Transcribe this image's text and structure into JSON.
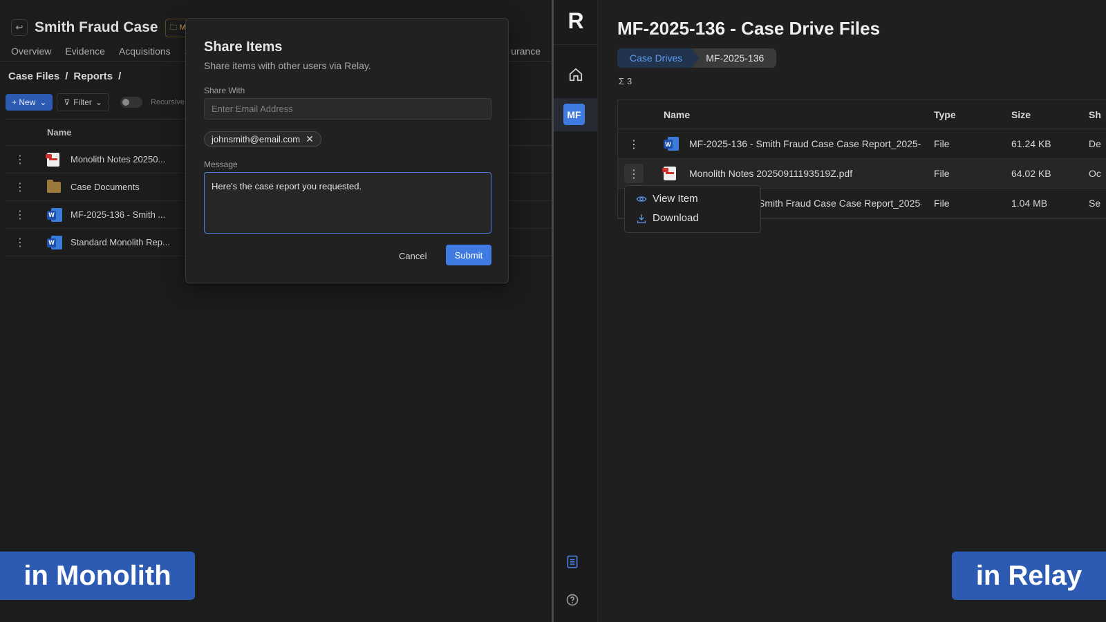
{
  "monolith": {
    "case_title": "Smith Fraud Case",
    "case_chip": "MF",
    "tabs": [
      "Overview",
      "Evidence",
      "Acquisitions",
      "S"
    ],
    "tab_tail": "urance",
    "breadcrumb": [
      "Case Files",
      "Reports"
    ],
    "breadcrumb_sep": "/",
    "toolbar": {
      "new_label": "+ New",
      "filter_label": "Filter",
      "toggle_label": "Recursive"
    },
    "table": {
      "header_name": "Name",
      "rows": [
        {
          "icon": "pdf-icon",
          "name": "Monolith Notes 20250..."
        },
        {
          "icon": "folder-icon",
          "name": "Case Documents"
        },
        {
          "icon": "word-doc-icon",
          "name": "MF-2025-136 - Smith ..."
        },
        {
          "icon": "word-doc-icon",
          "name": "Standard Monolith Rep..."
        }
      ]
    }
  },
  "share_modal": {
    "title": "Share Items",
    "subtitle": "Share items with other users via Relay.",
    "share_with_label": "Share With",
    "email_placeholder": "Enter Email Address",
    "email_chip": "johnsmith@email.com",
    "message_label": "Message",
    "message_value": "Here's the case report you requested.",
    "cancel_label": "Cancel",
    "submit_label": "Submit"
  },
  "relay": {
    "logo": "R",
    "workspace_badge": "MF",
    "title": "MF-2025-136 - Case Drive Files",
    "breadcrumb": [
      "Case Drives",
      "MF-2025-136"
    ],
    "count_symbol": "Σ",
    "count": "3",
    "columns": [
      "Name",
      "Type",
      "Size",
      "Sh"
    ],
    "rows": [
      {
        "icon": "word-doc-icon",
        "name": "MF-2025-136 - Smith Fraud Case Case Report_2025-",
        "type": "File",
        "size": "61.24 KB",
        "shared": "De"
      },
      {
        "icon": "pdf-icon",
        "name": "Monolith Notes 20250911193519Z.pdf",
        "type": "File",
        "size": "64.02 KB",
        "shared": "Oc"
      },
      {
        "icon": "word-doc-icon",
        "name": "Smith Fraud Case Case Report_2025-",
        "type": "File",
        "size": "1.04 MB",
        "shared": "Se"
      }
    ],
    "context_menu": {
      "view": "View Item",
      "download": "Download"
    }
  },
  "captions": {
    "left": "in Monolith",
    "right": "in Relay"
  },
  "colors": {
    "accent": "#3f7be0",
    "caption_bg": "#2d5bb3",
    "background": "#1c1c1c"
  }
}
